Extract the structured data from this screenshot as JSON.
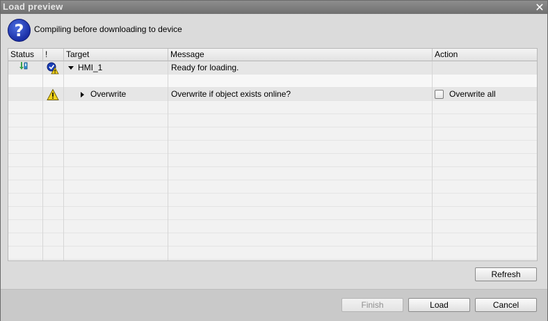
{
  "window": {
    "title": "Load preview",
    "close_glyph": "✕"
  },
  "header": {
    "icon": "question-icon",
    "icon_glyph": "?",
    "text": "Compiling before downloading to device"
  },
  "grid": {
    "columns": [
      {
        "label": "Status"
      },
      {
        "label": "!"
      },
      {
        "label": "Target"
      },
      {
        "label": "Message"
      },
      {
        "label": "Action"
      }
    ],
    "rows": [
      {
        "status_icon": "download-to-device-icon",
        "severity_icon": "check-warning-icon",
        "target": "HMI_1",
        "expand": "expanded",
        "message": "Ready for loading.",
        "action": ""
      },
      {
        "status_icon": "",
        "severity_icon": "",
        "target": "",
        "message": "",
        "action": ""
      },
      {
        "status_icon": "",
        "severity_icon": "warning-icon",
        "target": "Overwrite",
        "expand": "collapsed",
        "message": "Overwrite if object exists online?",
        "action": "Overwrite all",
        "action_checked": false
      }
    ]
  },
  "buttons": {
    "refresh": "Refresh",
    "finish": "Finish",
    "load": "Load",
    "cancel": "Cancel"
  },
  "colors": {
    "accent_blue": "#1a2fa6",
    "warning_yellow": "#f2d21c",
    "status_green": "#3aa34a"
  }
}
